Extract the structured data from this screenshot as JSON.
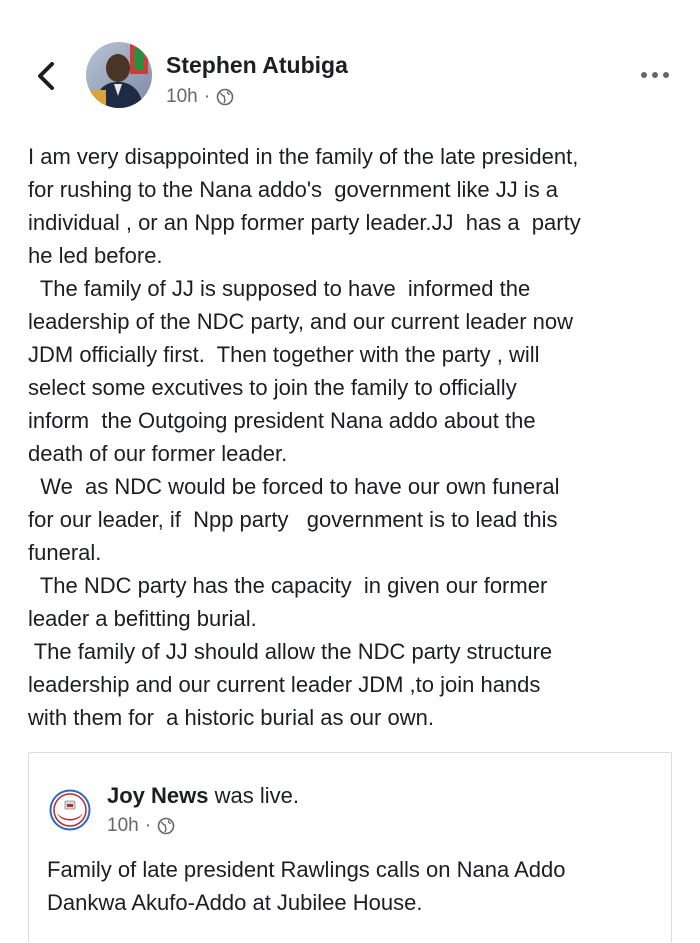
{
  "post": {
    "author": "Stephen Atubiga",
    "time": "10h",
    "separator": "·",
    "body_lines": [
      "I am very disappointed in the family of the late president,",
      "for rushing to the Nana addo's  government like JJ is a",
      "individual , or an Npp former party leader.JJ  has a  party",
      "he led before.",
      "  The family of JJ is supposed to have  informed the",
      "leadership of the NDC party, and our current leader now",
      "JDM officially first.  Then together with the party , will",
      "select some excutives to join the family to officially",
      "inform  the Outgoing president Nana addo about the",
      "death of our former leader.",
      "  We  as NDC would be forced to have our own funeral",
      "for our leader, if  Npp party   government is to lead this",
      "funeral.",
      "  The NDC party has the capacity  in given our former",
      "leader a befitting burial.",
      " The family of JJ should allow the NDC party structure",
      "leadership and our current leader JDM ,to join hands",
      "with them for  a historic burial as our own."
    ]
  },
  "shared": {
    "page_name": "Joy News",
    "status": " was live.",
    "time": "10h",
    "separator": "·",
    "text_lines": [
      "Family of late president Rawlings calls on Nana Addo",
      "Dankwa Akufo-Addo at Jubilee House."
    ]
  },
  "icons": {
    "back": "chevron-left-icon",
    "more": "more-horizontal-icon",
    "audience": "globe-icon",
    "page_logo": "joy-news-logo-icon"
  },
  "colors": {
    "text": "#1c1e21",
    "secondary_text": "#65676b",
    "card_border": "#dadde1",
    "logo_red": "#c0272d",
    "logo_blue": "#2a6bc2"
  }
}
